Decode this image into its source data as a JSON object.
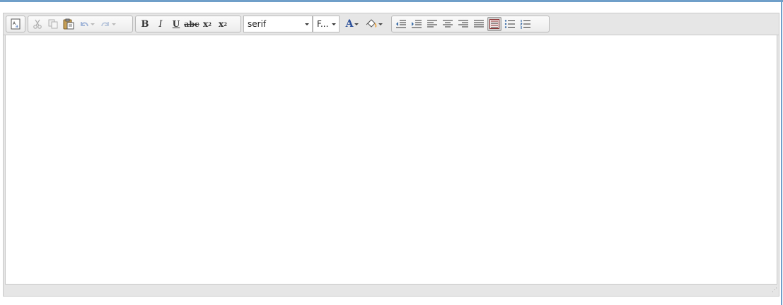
{
  "toolbar": {
    "source_button": {
      "icon": "source-document-icon"
    },
    "clipboard": {
      "cut_icon": "scissors-icon",
      "copy_icon": "copy-icon",
      "paste_icon": "paste-icon",
      "undo_icon": "undo-icon",
      "redo_icon": "redo-icon"
    },
    "formatting": {
      "bold_label": "B",
      "italic_label": "I",
      "underline_label": "U",
      "strikethrough_label": "abc",
      "superscript_label": "x",
      "superscript_mark": "2",
      "subscript_label": "x",
      "subscript_mark": "2"
    },
    "font_family": {
      "value": "serif"
    },
    "font_size": {
      "value": "F..."
    },
    "text_color": {
      "label": "A",
      "icon": "text-color-icon"
    },
    "background_color": {
      "icon": "paint-bucket-icon"
    },
    "alignment": {
      "icons": [
        "outdent-icon",
        "indent-icon",
        "align-left-icon",
        "align-center-icon",
        "align-right-icon",
        "justify-icon",
        "direction-icon",
        "bulleted-list-icon",
        "numbered-list-icon"
      ],
      "active": "direction-icon"
    },
    "colors": {
      "toolbar_bg": "#e6e6e6",
      "border": "#c9c9c9",
      "accent_rule": "#6f9fc9"
    }
  },
  "editor": {
    "content": "",
    "statusbar": {
      "grip": "⋰"
    }
  }
}
